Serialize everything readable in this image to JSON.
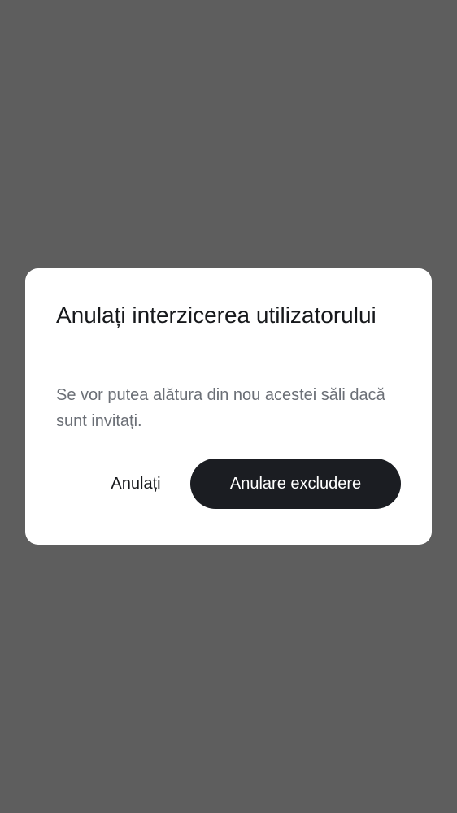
{
  "dialog": {
    "title": "Anulați interzicerea utilizatorului",
    "body": "Se vor putea alătura din nou acestei săli dacă sunt invitați.",
    "cancel_label": "Anulați",
    "confirm_label": "Anulare excludere"
  },
  "colors": {
    "scrim": "#5e5e5e",
    "dialog_background": "#ffffff",
    "primary_button": "#1b1d22",
    "title_text": "#17191c",
    "body_text": "#6b6f76"
  }
}
